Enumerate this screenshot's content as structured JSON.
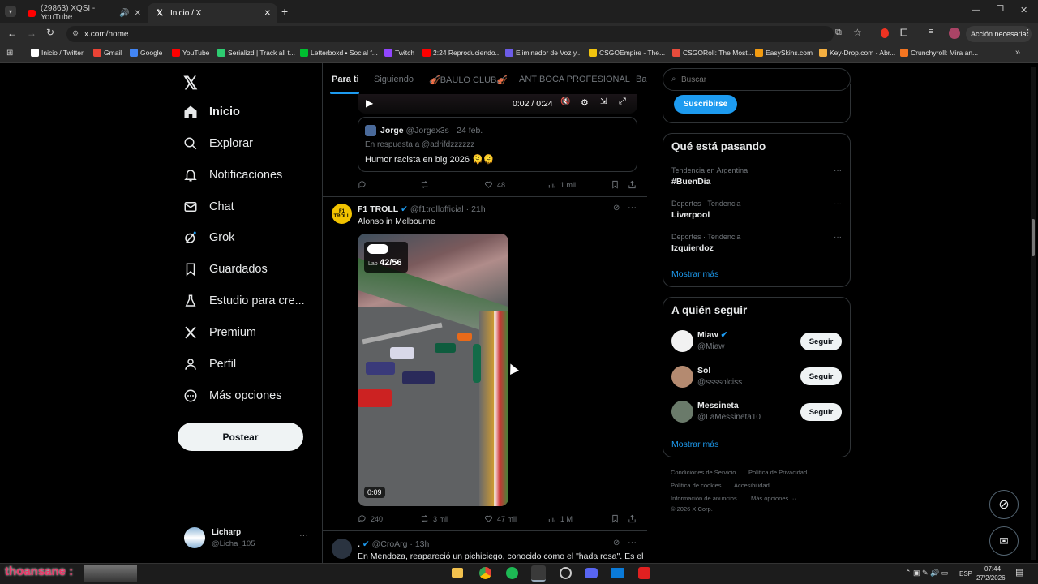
{
  "browser": {
    "tabs": [
      {
        "title": "(29863) XQSI - YouTube"
      },
      {
        "title": "Inicio / X"
      }
    ],
    "url": "x.com/home",
    "profile_button": "Acción necesaria",
    "bookmarks": [
      {
        "label": "Inicio / Twitter",
        "color": "#ffffff"
      },
      {
        "label": "Gmail",
        "color": "#ea4335"
      },
      {
        "label": "Google",
        "color": "#4285f4"
      },
      {
        "label": "YouTube",
        "color": "#ff0000"
      },
      {
        "label": "Serializd | Track all t...",
        "color": "#2ecc71"
      },
      {
        "label": "Letterboxd • Social f...",
        "color": "#00c030"
      },
      {
        "label": "Twitch",
        "color": "#9146ff"
      },
      {
        "label": "2:24 Reproduciendo...",
        "color": "#ff0000"
      },
      {
        "label": "Eliminador de Voz y...",
        "color": "#6c5ce7"
      },
      {
        "label": "CSGOEmpire - The...",
        "color": "#f1c40f"
      },
      {
        "label": "CSGORoll: The Most...",
        "color": "#e74c3c"
      },
      {
        "label": "EasySkins.com",
        "color": "#f39c12"
      },
      {
        "label": "Key-Drop.com - Abr...",
        "color": "#f5b041"
      },
      {
        "label": "Crunchyroll: Mira an...",
        "color": "#f47521"
      }
    ]
  },
  "sidebar": {
    "items": [
      {
        "label": "Inicio"
      },
      {
        "label": "Explorar"
      },
      {
        "label": "Notificaciones"
      },
      {
        "label": "Chat"
      },
      {
        "label": "Grok"
      },
      {
        "label": "Guardados"
      },
      {
        "label": "Estudio para cre..."
      },
      {
        "label": "Premium"
      },
      {
        "label": "Perfil"
      },
      {
        "label": "Más opciones"
      }
    ],
    "post_button": "Postear",
    "account": {
      "name": "Licharp",
      "handle": "@Licha_105"
    }
  },
  "feed": {
    "tabs": [
      "Para ti",
      "Siguiendo",
      "🎻BAULO CLUB🎻",
      "ANTIBOCA PROFESIONAL",
      "Ba"
    ],
    "video_time": "0:02 / 0:24",
    "quoted": {
      "name": "Jorge",
      "handle": "@Jorgex3s",
      "date": "· 24 feb.",
      "reply_to": "En respuesta a @adrifdzzzzzz",
      "text": "Humor racista en big 2026 🫠🫠"
    },
    "tweet1_actions": {
      "retweets": "",
      "likes": "48",
      "views": "1 mil"
    },
    "tweet2": {
      "name": "F1 TROLL",
      "handle": "@f1trollofficial",
      "time": "· 21h",
      "text": "Alonso in Melbourne",
      "lap": "42/56",
      "lap_label": "Lap",
      "duration": "0:09",
      "replies": "240",
      "retweets": "3 mil",
      "likes": "47 mil",
      "views": "1 M"
    },
    "tweet3": {
      "name": ".",
      "handle": "@CroArg",
      "time": "· 13h",
      "text": "En Mendoza, reapareció un pichiciego, conocido como el \"hada rosa\". Es el"
    }
  },
  "right": {
    "search_placeholder": "Buscar",
    "subscribe": "Suscribirse",
    "trends_title": "Qué está pasando",
    "trends": [
      {
        "context": "Tendencia en Argentina",
        "name": "#BuenDia"
      },
      {
        "context": "Deportes · Tendencia",
        "name": "Liverpool"
      },
      {
        "context": "Deportes · Tendencia",
        "name": "Izquierdoz"
      }
    ],
    "show_more": "Mostrar más",
    "follow_title": "A quién seguir",
    "follow": [
      {
        "name": "Miaw",
        "handle": "@Miaw"
      },
      {
        "name": "Sol",
        "handle": "@ssssolciss"
      },
      {
        "name": "Messineta",
        "handle": "@LaMessineta10"
      }
    ],
    "follow_button": "Seguir",
    "footer": [
      "Condiciones de Servicio",
      "Política de Privacidad",
      "Política de cookies",
      "Accesibilidad",
      "Información de anuncios",
      "Más opciones ···",
      "© 2026 X Corp."
    ]
  },
  "taskbar": {
    "overlay_text": "thoansane :",
    "lang": "ESP",
    "time": "07:44",
    "date": "27/2/2026"
  },
  "colors": {
    "accent": "#1d9bf0",
    "background": "#000000"
  }
}
